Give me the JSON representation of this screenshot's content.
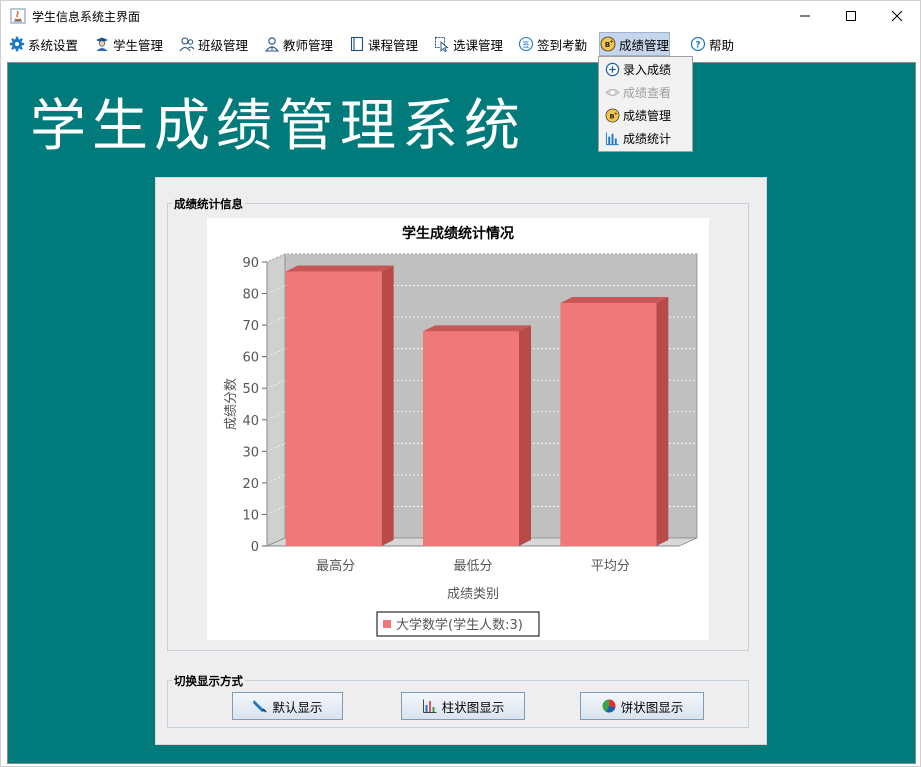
{
  "window": {
    "title": "学生信息系统主界面"
  },
  "menubar": {
    "items": [
      {
        "label": "系统设置",
        "icon": "gear-icon"
      },
      {
        "label": "学生管理",
        "icon": "student-icon"
      },
      {
        "label": "班级管理",
        "icon": "class-icon"
      },
      {
        "label": "教师管理",
        "icon": "teacher-icon"
      },
      {
        "label": "课程管理",
        "icon": "course-icon"
      },
      {
        "label": "选课管理",
        "icon": "select-course-icon"
      },
      {
        "label": "签到考勤",
        "icon": "attendance-icon"
      },
      {
        "label": "成绩管理",
        "icon": "grade-icon"
      },
      {
        "label": "帮助",
        "icon": "help-icon"
      }
    ]
  },
  "dropdown": {
    "items": [
      {
        "label": "录入成绩",
        "icon": "plus-circle-icon",
        "enabled": true
      },
      {
        "label": "成绩查看",
        "icon": "eye-icon",
        "enabled": false
      },
      {
        "label": "成绩管理",
        "icon": "grade-icon",
        "enabled": true
      },
      {
        "label": "成绩统计",
        "icon": "bar-chart-icon",
        "enabled": true
      }
    ]
  },
  "banner": {
    "text": "学生成绩管理系统"
  },
  "panel": {
    "stats_group_title": "成绩统计信息",
    "switch_group_title": "切换显示方式",
    "buttons": {
      "default": "默认显示",
      "bar": "柱状图显示",
      "pie": "饼状图显示"
    }
  },
  "colors": {
    "desktop": "#007a7a",
    "bar": "#f07878",
    "menu_active": "#c6d6ea"
  },
  "chart_data": {
    "type": "bar",
    "title": "学生成绩统计情况",
    "xlabel": "成绩类别",
    "ylabel": "成绩分数",
    "categories": [
      "最高分",
      "最低分",
      "平均分"
    ],
    "series": [
      {
        "name": "大学数学(学生人数:3)",
        "values": [
          87,
          68,
          77
        ]
      }
    ],
    "ylim": [
      0,
      90
    ],
    "yticks": [
      0,
      10,
      20,
      30,
      40,
      50,
      60,
      70,
      80,
      90
    ],
    "grid": true,
    "legend": "bottom"
  }
}
